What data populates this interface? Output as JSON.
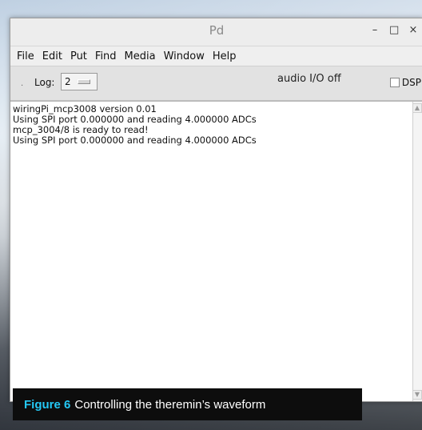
{
  "window": {
    "title": "Pd",
    "controls": {
      "minimize": "–",
      "maximize": "□",
      "close": "×"
    }
  },
  "menubar": {
    "items": [
      "File",
      "Edit",
      "Put",
      "Find",
      "Media",
      "Window",
      "Help"
    ]
  },
  "toolbar": {
    "log_label": "Log:",
    "log_value": "2",
    "audio_status": "audio I/O off",
    "dsp_label": "DSP",
    "dsp_checked": false
  },
  "console": {
    "lines": [
      "wiringPi_mcp3008 version 0.01",
      "Using SPI port 0.000000 and reading 4.000000 ADCs",
      "mcp_3004/8 is ready to read!",
      "Using SPI port 0.000000 and reading 4.000000 ADCs"
    ]
  },
  "caption": {
    "label": "Figure 6",
    "text": "Controlling the theremin’s waveform",
    "label_color": "#24c8f5"
  }
}
